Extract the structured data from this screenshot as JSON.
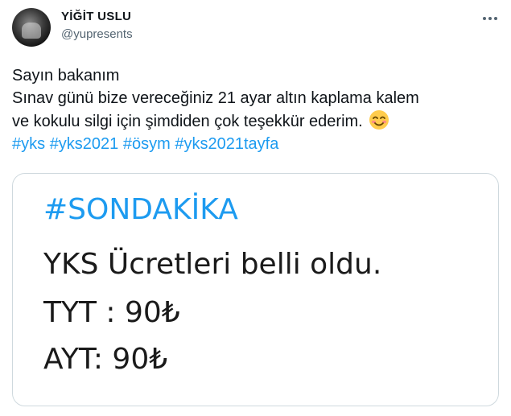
{
  "tweet": {
    "author_name": "YİĞİT USLU",
    "author_handle": "@yupresents",
    "text_lines": [
      "Sayın bakanım",
      "Sınav günü bize vereceğiniz 21 ayar altın kaplama kalem",
      "ve kokulu silgi için şimdiden çok teşekkür ederim."
    ],
    "emoji": "smiling-face-icon",
    "hashtags": [
      "#yks",
      "#yks2021",
      "#ösym",
      "#yks2021tayfa"
    ]
  },
  "image": {
    "lines": [
      "#SONDAKİKA",
      "YKS Ücretleri belli oldu.",
      "TYT : 90₺",
      "AYT: 90₺"
    ]
  },
  "colors": {
    "link": "#1d9bf0",
    "text": "#0f1419",
    "muted": "#536471",
    "border": "#cfd9de"
  }
}
